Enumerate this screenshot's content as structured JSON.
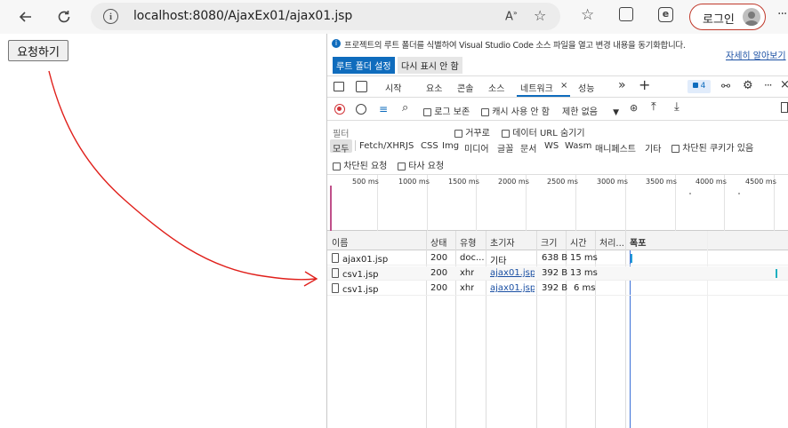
{
  "browser": {
    "url": "localhost:8080/AjaxEx01/ajax01.jsp",
    "login_label": "로그인"
  },
  "page": {
    "request_button_label": "요청하기"
  },
  "devtools": {
    "infobar": {
      "message": "프로젝트의 루트 폴더를 식별하여 Visual Studio Code 소스 파일을 열고 변경 내용을 동기화합니다.",
      "learn_more": "자세히 알아보기",
      "set_root_button": "루트 폴더 설정",
      "dont_show_button": "다시 표시 안 함"
    },
    "tabs": [
      "시작",
      "요소",
      "콘솔",
      "소스",
      "네트워크",
      "성능"
    ],
    "issue_count": "4",
    "toolbar": {
      "invert_label": "로그 보존",
      "disable_cache_label": "캐시 사용 안 함",
      "throttle_value": "제한 없음"
    },
    "filter": {
      "placeholder": "필터",
      "invert_label": "거꾸로",
      "hide_data_url_label": "데이터 URL 숨기기",
      "types": [
        "모두",
        "Fetch/XHR",
        "JS",
        "CSS",
        "Img",
        "미디어",
        "글꼴",
        "문서",
        "WS",
        "Wasm",
        "매니페스트",
        "기타"
      ],
      "blocked_cookies_label": "차단된 쿠키가 있음",
      "blocked_requests_label": "차단된 요청",
      "third_party_label": "타사 요청"
    },
    "timeline_ticks": [
      "500 ms",
      "1000 ms",
      "1500 ms",
      "2000 ms",
      "2500 ms",
      "3000 ms",
      "3500 ms",
      "4000 ms",
      "4500 ms"
    ],
    "columns": [
      "이름",
      "상태",
      "유형",
      "초기자",
      "크기",
      "시간",
      "처리...",
      "폭포"
    ],
    "rows": [
      {
        "name": "ajax01.jsp",
        "status": "200",
        "type": "doc...",
        "initiator": "기타",
        "size": "638 B",
        "time": "15 ms"
      },
      {
        "name": "csv1.jsp",
        "status": "200",
        "type": "xhr",
        "initiator": "ajax01.jsp...",
        "size": "392 B",
        "time": "13 ms"
      },
      {
        "name": "csv1.jsp",
        "status": "200",
        "type": "xhr",
        "initiator": "ajax01.jsp...",
        "size": "392 B",
        "time": "6 ms"
      }
    ]
  },
  "colors": {
    "accent": "#0f6cbd",
    "annotation": "#e0201b",
    "login_border": "#c0392b"
  }
}
